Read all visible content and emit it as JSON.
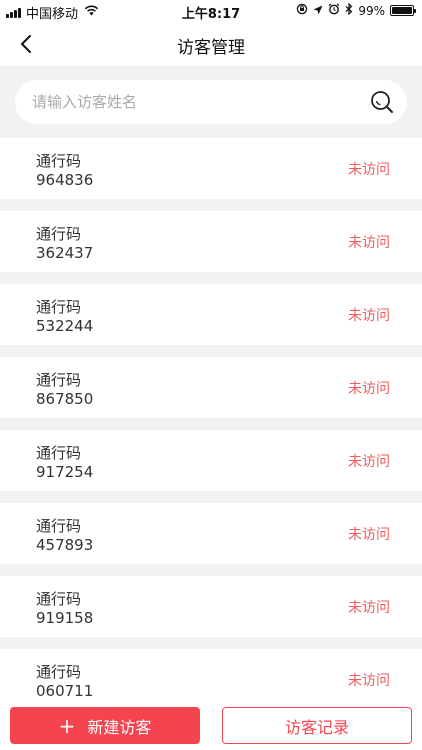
{
  "status_bar": {
    "carrier": "中国移动",
    "time": "上午8:17",
    "battery": "99%",
    "battery_level": 0.99
  },
  "nav": {
    "title": "访客管理"
  },
  "search": {
    "placeholder": "请输入访客姓名"
  },
  "visitors": [
    {
      "label": "通行码",
      "code": "964836",
      "status": "未访问"
    },
    {
      "label": "通行码",
      "code": "362437",
      "status": "未访问"
    },
    {
      "label": "通行码",
      "code": "532244",
      "status": "未访问"
    },
    {
      "label": "通行码",
      "code": "867850",
      "status": "未访问"
    },
    {
      "label": "通行码",
      "code": "917254",
      "status": "未访问"
    },
    {
      "label": "通行码",
      "code": "457893",
      "status": "未访问"
    },
    {
      "label": "通行码",
      "code": "919158",
      "status": "未访问"
    },
    {
      "label": "通行码",
      "code": "060711",
      "status": "未访问"
    }
  ],
  "bottom": {
    "new_visitor": "新建访客",
    "records": "访客记录"
  },
  "colors": {
    "accent": "#f4444f",
    "status_text": "#f05a5a"
  }
}
